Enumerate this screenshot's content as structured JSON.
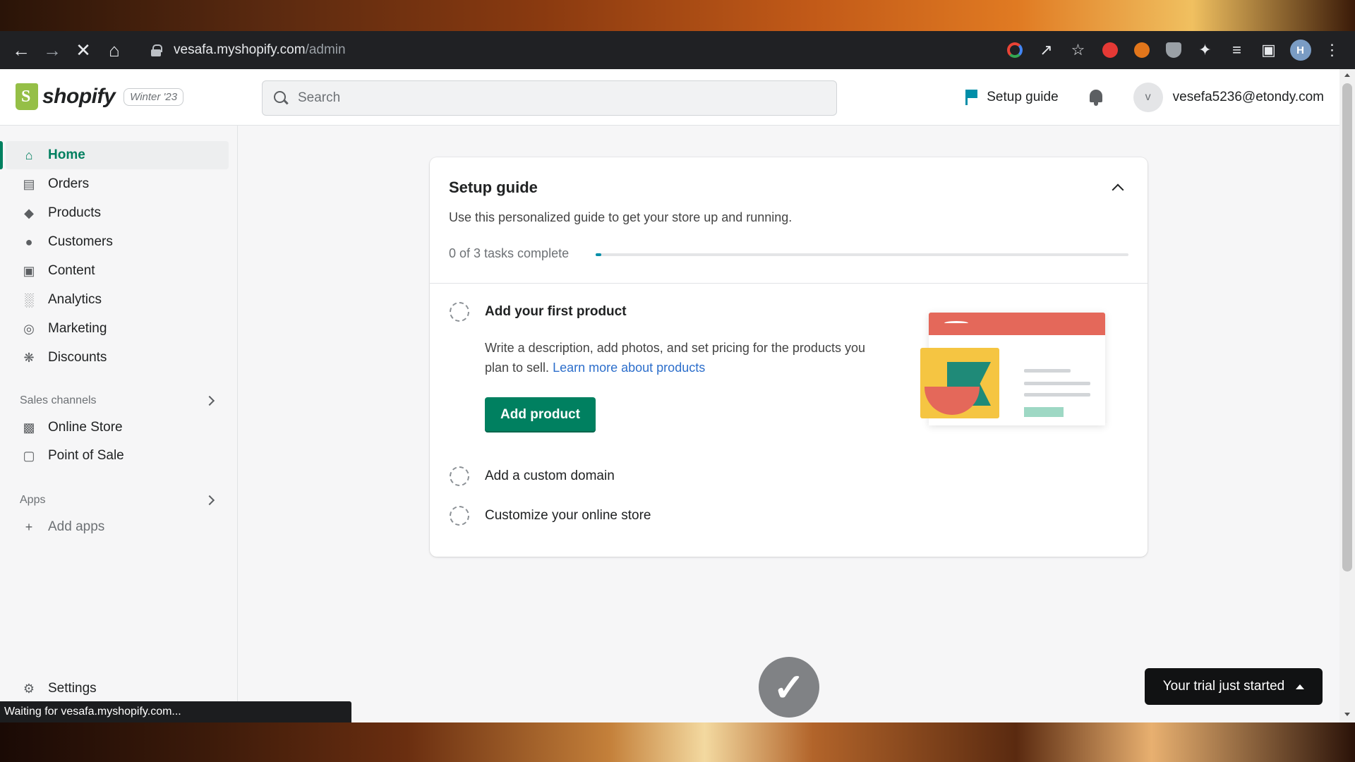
{
  "browser": {
    "url_host": "vesafa.myshopify.com",
    "url_path": "/admin",
    "profile_initial": "H",
    "status_text": "Waiting for vesafa.myshopify.com...",
    "nav_icons": [
      "back-icon",
      "forward-icon",
      "stop-icon",
      "home-icon"
    ],
    "toolbar_icons": [
      "google-icon",
      "share-icon",
      "bookmark-star-icon",
      "extension-red-icon",
      "metamask-icon",
      "shield-extension-icon",
      "puzzle-icon",
      "reading-list-icon",
      "side-panel-icon",
      "profile-avatar",
      "kebab-menu-icon"
    ]
  },
  "topbar": {
    "brand": "shopify",
    "edition_badge": "Winter '23",
    "search_placeholder": "Search",
    "setup_guide_label": "Setup guide",
    "user_initial": "v",
    "user_email": "vesefa5236@etondy.com"
  },
  "sidebar": {
    "items": [
      {
        "label": "Home",
        "icon": "home-icon",
        "active": true
      },
      {
        "label": "Orders",
        "icon": "orders-inbox-icon"
      },
      {
        "label": "Products",
        "icon": "tag-icon"
      },
      {
        "label": "Customers",
        "icon": "person-icon"
      },
      {
        "label": "Content",
        "icon": "content-icon"
      },
      {
        "label": "Analytics",
        "icon": "bar-chart-icon"
      },
      {
        "label": "Marketing",
        "icon": "target-icon"
      },
      {
        "label": "Discounts",
        "icon": "discount-icon"
      }
    ],
    "sales_channels_heading": "Sales channels",
    "sales_channels": [
      {
        "label": "Online Store",
        "icon": "store-icon"
      },
      {
        "label": "Point of Sale",
        "icon": "pos-icon"
      }
    ],
    "apps_heading": "Apps",
    "add_apps_label": "Add apps",
    "settings_label": "Settings"
  },
  "setup_card": {
    "title": "Setup guide",
    "subtitle": "Use this personalized guide to get your store up and running.",
    "progress_text": "0 of 3 tasks complete",
    "progress_fraction": 0.01,
    "tasks": [
      {
        "title": "Add your first product",
        "expanded": true
      },
      {
        "title": "Add a custom domain",
        "expanded": false
      },
      {
        "title": "Customize your online store",
        "expanded": false
      }
    ],
    "task_description": "Write a description, add photos, and set pricing for the products you plan to sell.",
    "task_link": "Learn more about products",
    "primary_button": "Add product"
  },
  "trial_button": "Your trial just started",
  "colors": {
    "accent_green": "#008060",
    "progress_teal": "#008ea8",
    "link_blue": "#2c6ecb"
  }
}
